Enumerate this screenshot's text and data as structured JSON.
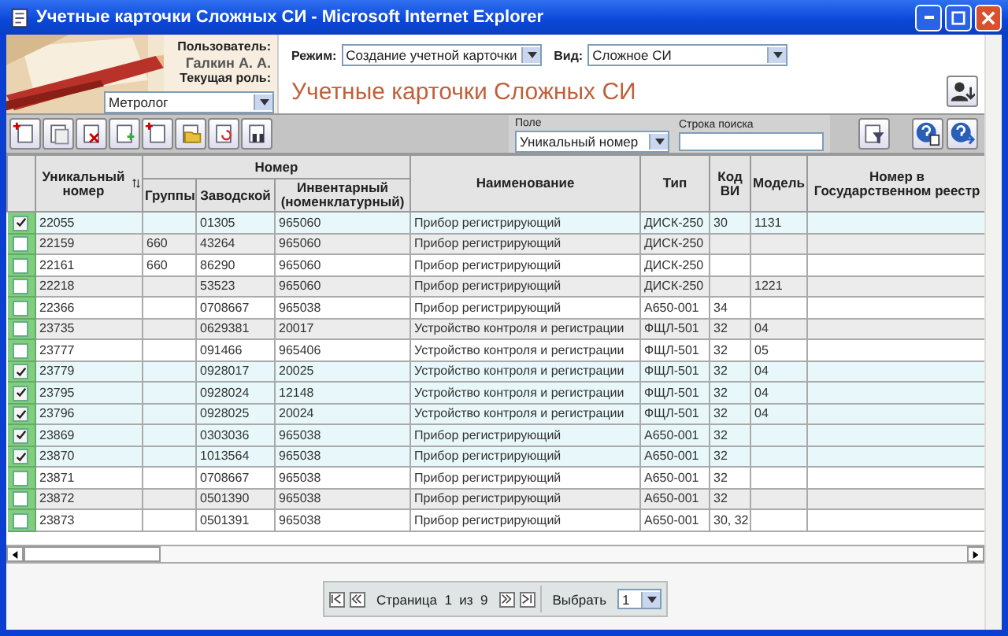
{
  "window": {
    "title": "Учетные карточки Сложных СИ - Microsoft Internet Explorer"
  },
  "user_panel": {
    "user_label": "Пользователь:",
    "user_name": "Галкин А. А.",
    "role_label": "Текущая роль:",
    "role": "Метролог"
  },
  "filters": [
    {
      "label": "Режим:",
      "value": "Создание учетной карточки",
      "kind": "wide"
    },
    {
      "label": "Вид:",
      "value": "Сложное СИ",
      "kind": "wide"
    }
  ],
  "page_title": "Учетные карточки Сложных СИ",
  "search": {
    "field_label": "Поле",
    "field_value": "Уникальный номер",
    "query_label": "Строка поиска"
  },
  "table": {
    "columns": [
      {
        "label": "Уникальный номер",
        "sortable": true
      },
      {
        "group": "Номер",
        "subcolumns": [
          "Группы",
          "Заводской",
          "Инвентарный (номенклатурный)"
        ]
      },
      {
        "label": "Наименование"
      },
      {
        "label": "Тип"
      },
      {
        "label": "Код ВИ"
      },
      {
        "label": "Модель"
      },
      {
        "label": "Номер в Государственном реестр"
      }
    ],
    "rows": [
      {
        "checked": true,
        "unique": "22055",
        "serial": "01305",
        "inventory": "965060",
        "name": "Прибор регистрирующий",
        "type": "ДИСК-250",
        "code": "30",
        "model": "1131"
      },
      {
        "checked": false,
        "unique": "22159",
        "group": "660",
        "serial": "43264",
        "inventory": "965060",
        "name": "Прибор регистрирующий",
        "type": "ДИСК-250"
      },
      {
        "checked": false,
        "unique": "22161",
        "group": "660",
        "serial": "86290",
        "inventory": "965060",
        "name": "Прибор регистрирующий",
        "type": "ДИСК-250"
      },
      {
        "checked": false,
        "unique": "22218",
        "serial": "53523",
        "inventory": "965060",
        "name": "Прибор регистрирующий",
        "type": "ДИСК-250",
        "model": "1221"
      },
      {
        "checked": false,
        "unique": "22366",
        "serial": "0708667",
        "inventory": "965038",
        "name": "Прибор регистрирующий",
        "type": "А650-001",
        "code": "34"
      },
      {
        "checked": false,
        "unique": "23735",
        "serial": "0629381",
        "inventory": "20017",
        "name": "Устройство контроля и регистрации",
        "type": "ФЩЛ-501",
        "code": "32",
        "model": "04"
      },
      {
        "checked": false,
        "unique": "23777",
        "serial": "091466",
        "inventory": "965406",
        "name": "Устройство контроля и регистрации",
        "type": "ФЩЛ-501",
        "code": "32",
        "model": "05"
      },
      {
        "checked": true,
        "unique": "23779",
        "serial": "0928017",
        "inventory": "20025",
        "name": "Устройство контроля и регистрации",
        "type": "ФЩЛ-501",
        "code": "32",
        "model": "04"
      },
      {
        "checked": true,
        "unique": "23795",
        "serial": "0928024",
        "inventory": "12148",
        "name": "Устройство контроля и регистрации",
        "type": "ФЩЛ-501",
        "code": "32",
        "model": "04"
      },
      {
        "checked": true,
        "unique": "23796",
        "serial": "0928025",
        "inventory": "20024",
        "name": "Устройство контроля и регистрации",
        "type": "ФЩЛ-501",
        "code": "32",
        "model": "04"
      },
      {
        "checked": true,
        "unique": "23869",
        "serial": "0303036",
        "inventory": "965038",
        "name": "Прибор регистрирующий",
        "type": "А650-001",
        "code": "32"
      },
      {
        "checked": true,
        "unique": "23870",
        "serial": "1013564",
        "inventory": "965038",
        "name": "Прибор регистрирующий",
        "type": "А650-001",
        "code": "32"
      },
      {
        "checked": false,
        "unique": "23871",
        "serial": "0708667",
        "inventory": "965038",
        "name": "Прибор регистрирующий",
        "type": "А650-001",
        "code": "32"
      },
      {
        "checked": false,
        "unique": "23872",
        "serial": "0501390",
        "inventory": "965038",
        "name": "Прибор регистрирующий",
        "type": "А650-001",
        "code": "32"
      },
      {
        "checked": false,
        "unique": "23873",
        "serial": "0501391",
        "inventory": "965038",
        "name": "Прибор регистрирующий",
        "type": "А650-001",
        "code": "30, 32"
      }
    ]
  },
  "pager": {
    "page_text": "Страница",
    "page": "1",
    "of": "из",
    "total": "9",
    "choose_label": "Выбрать",
    "choose_value": "1"
  }
}
